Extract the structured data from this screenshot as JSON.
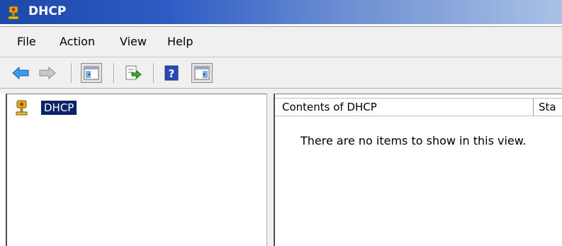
{
  "window": {
    "title": "DHCP",
    "icon": "dhcp-server-icon",
    "title_gradient": [
      "#1c48a8",
      "#aac1e6"
    ]
  },
  "menu": {
    "items": [
      {
        "label": "File"
      },
      {
        "label": "Action"
      },
      {
        "label": "View"
      },
      {
        "label": "Help"
      }
    ]
  },
  "toolbar": {
    "buttons": [
      {
        "icon": "back-arrow-icon"
      },
      {
        "icon": "forward-arrow-icon"
      },
      {
        "icon": "show-hide-console-tree-icon",
        "pressed": true
      },
      {
        "icon": "export-list-icon"
      },
      {
        "icon": "help-icon"
      },
      {
        "icon": "show-hide-action-pane-icon",
        "pressed": true
      }
    ]
  },
  "tree": {
    "root": {
      "label": "DHCP",
      "icon": "dhcp-server-icon",
      "selected": true
    }
  },
  "list": {
    "columns": [
      {
        "label": "Contents of DHCP"
      },
      {
        "label": "Sta"
      }
    ],
    "empty_message": "There are no items to show in this view."
  },
  "colors": {
    "selection": "#0a246a",
    "chrome": "#f0f0f0"
  }
}
